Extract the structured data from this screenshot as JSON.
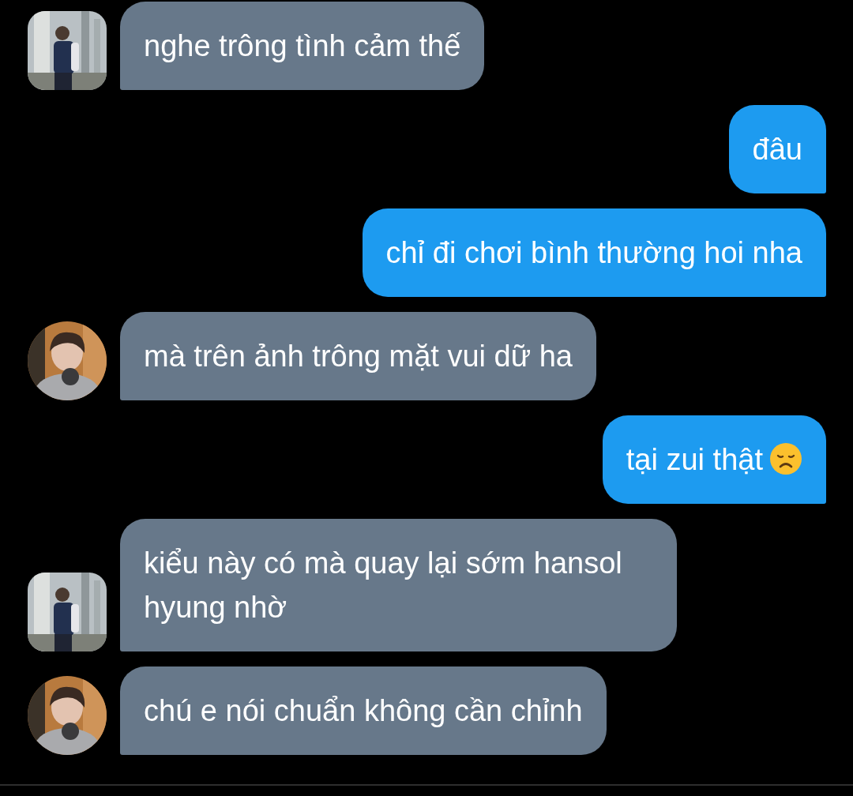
{
  "messages": [
    {
      "kind": "incoming",
      "avatar": {
        "kind": "picture",
        "round": false
      },
      "text": "nghe trông tình cảm thế",
      "trailing_icon": false
    },
    {
      "kind": "outgoing",
      "text": "đâu",
      "trailing_icon": false
    },
    {
      "kind": "outgoing",
      "text": "chỉ đi chơi bình thường hoi nha",
      "trailing_icon": false
    },
    {
      "kind": "incoming",
      "avatar": {
        "kind": "picture",
        "round": true
      },
      "text": "mà trên ảnh trông mặt vui dữ ha",
      "trailing_icon": false
    },
    {
      "kind": "outgoing",
      "text": "tại zui thật",
      "trailing_icon": true
    },
    {
      "kind": "incoming",
      "avatar": {
        "kind": "picture",
        "round": false
      },
      "text": "kiểu này có mà quay lại sớm hansol hyung nhờ",
      "trailing_icon": false
    },
    {
      "kind": "incoming",
      "avatar": {
        "kind": "picture",
        "round": true
      },
      "text": "chú e nói chuẩn không cần chỉnh",
      "trailing_icon": false
    }
  ]
}
